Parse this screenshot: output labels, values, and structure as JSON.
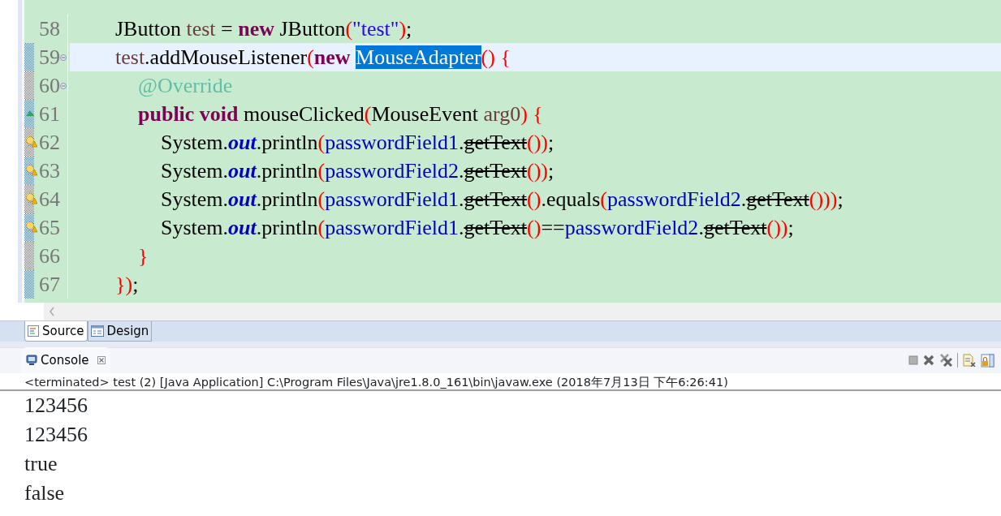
{
  "editor": {
    "lines": [
      {
        "number": "58",
        "changed": false,
        "current": false,
        "tokens": [
          {
            "text": "\t\tJButton ",
            "kind": "plain"
          },
          {
            "text": "test",
            "kind": "local"
          },
          {
            "text": " = ",
            "kind": "plain"
          },
          {
            "text": "new",
            "kind": "keyword"
          },
          {
            "text": " JButton",
            "kind": "plain"
          },
          {
            "text": "(",
            "kind": "paren"
          },
          {
            "text": "\"test\"",
            "kind": "string"
          },
          {
            "text": ")",
            "kind": "paren"
          },
          {
            "text": ";",
            "kind": "plain"
          }
        ]
      },
      {
        "number": "59",
        "changed": true,
        "current": true,
        "kind": "fold",
        "tokens": [
          {
            "text": "\t\ttest",
            "kind": "local"
          },
          {
            "text": ".addMouseListener",
            "kind": "plain"
          },
          {
            "text": "(",
            "kind": "paren"
          },
          {
            "text": "new ",
            "kind": "keyword"
          },
          {
            "text": "MouseAdapter",
            "kind": "selection"
          },
          {
            "text": "() {",
            "kind": "paren"
          }
        ]
      },
      {
        "number": "60",
        "changed": true,
        "current": false,
        "kind": "fold",
        "tokens": [
          {
            "text": "\t\t\t@Override",
            "kind": "annotation"
          }
        ]
      },
      {
        "number": "61",
        "changed": true,
        "current": false,
        "kind": "override",
        "tokens": [
          {
            "text": "\t\t\tpublic void",
            "kind": "keyword"
          },
          {
            "text": " mouseClicked",
            "kind": "plain"
          },
          {
            "text": "(",
            "kind": "paren"
          },
          {
            "text": "MouseEvent ",
            "kind": "plain"
          },
          {
            "text": "arg0",
            "kind": "local"
          },
          {
            "text": ") {",
            "kind": "paren"
          }
        ]
      },
      {
        "number": "62",
        "changed": true,
        "current": false,
        "kind": "warning",
        "tokens": [
          {
            "text": "\t\t\t\tSystem.",
            "kind": "plain"
          },
          {
            "text": "out",
            "kind": "field"
          },
          {
            "text": ".println",
            "kind": "plain"
          },
          {
            "text": "(",
            "kind": "paren"
          },
          {
            "text": "passwordField1",
            "kind": "member"
          },
          {
            "text": ".",
            "kind": "plain"
          },
          {
            "text": "getText",
            "kind": "deprecated"
          },
          {
            "text": "())",
            "kind": "paren"
          },
          {
            "text": ";",
            "kind": "plain"
          }
        ]
      },
      {
        "number": "63",
        "changed": true,
        "current": false,
        "kind": "warning",
        "tokens": [
          {
            "text": "\t\t\t\tSystem.",
            "kind": "plain"
          },
          {
            "text": "out",
            "kind": "field"
          },
          {
            "text": ".println",
            "kind": "plain"
          },
          {
            "text": "(",
            "kind": "paren"
          },
          {
            "text": "passwordField2",
            "kind": "member"
          },
          {
            "text": ".",
            "kind": "plain"
          },
          {
            "text": "getText",
            "kind": "deprecated"
          },
          {
            "text": "())",
            "kind": "paren"
          },
          {
            "text": ";",
            "kind": "plain"
          }
        ]
      },
      {
        "number": "64",
        "changed": true,
        "current": false,
        "kind": "warning",
        "tokens": [
          {
            "text": "\t\t\t\tSystem.",
            "kind": "plain"
          },
          {
            "text": "out",
            "kind": "field"
          },
          {
            "text": ".println",
            "kind": "plain"
          },
          {
            "text": "(",
            "kind": "paren"
          },
          {
            "text": "passwordField1",
            "kind": "member"
          },
          {
            "text": ".",
            "kind": "plain"
          },
          {
            "text": "getText",
            "kind": "deprecated"
          },
          {
            "text": "()",
            "kind": "paren"
          },
          {
            "text": ".equals",
            "kind": "plain"
          },
          {
            "text": "(",
            "kind": "paren"
          },
          {
            "text": "passwordField2",
            "kind": "member"
          },
          {
            "text": ".",
            "kind": "plain"
          },
          {
            "text": "getText",
            "kind": "deprecated"
          },
          {
            "text": "()))",
            "kind": "paren"
          },
          {
            "text": ";",
            "kind": "plain"
          }
        ]
      },
      {
        "number": "65",
        "changed": true,
        "current": false,
        "kind": "warning",
        "tokens": [
          {
            "text": "\t\t\t\tSystem.",
            "kind": "plain"
          },
          {
            "text": "out",
            "kind": "field"
          },
          {
            "text": ".println",
            "kind": "plain"
          },
          {
            "text": "(",
            "kind": "paren"
          },
          {
            "text": "passwordField1",
            "kind": "member"
          },
          {
            "text": ".",
            "kind": "plain"
          },
          {
            "text": "getText",
            "kind": "deprecated"
          },
          {
            "text": "()",
            "kind": "paren"
          },
          {
            "text": "==",
            "kind": "plain"
          },
          {
            "text": "passwordField2",
            "kind": "member"
          },
          {
            "text": ".",
            "kind": "plain"
          },
          {
            "text": "getText",
            "kind": "deprecated"
          },
          {
            "text": "())",
            "kind": "paren"
          },
          {
            "text": ";",
            "kind": "plain"
          }
        ]
      },
      {
        "number": "66",
        "changed": true,
        "current": false,
        "tokens": [
          {
            "text": "\t\t\t}",
            "kind": "paren"
          }
        ]
      },
      {
        "number": "67",
        "changed": true,
        "current": false,
        "tokens": [
          {
            "text": "\t\t})",
            "kind": "paren"
          },
          {
            "text": ";",
            "kind": "plain"
          }
        ]
      }
    ]
  },
  "editor_tabs": [
    {
      "label": "Source",
      "selected": true,
      "kind": "source"
    },
    {
      "label": "Design",
      "selected": false,
      "kind": "design"
    }
  ],
  "console": {
    "tab": "Console",
    "status": "<terminated> test (2) [Java Application] C:\\Program Files\\Java\\jre1.8.0_161\\bin\\javaw.exe (2018年7月13日 下午6:26:41)",
    "output": [
      "123456",
      "123456",
      "true",
      "false"
    ]
  }
}
